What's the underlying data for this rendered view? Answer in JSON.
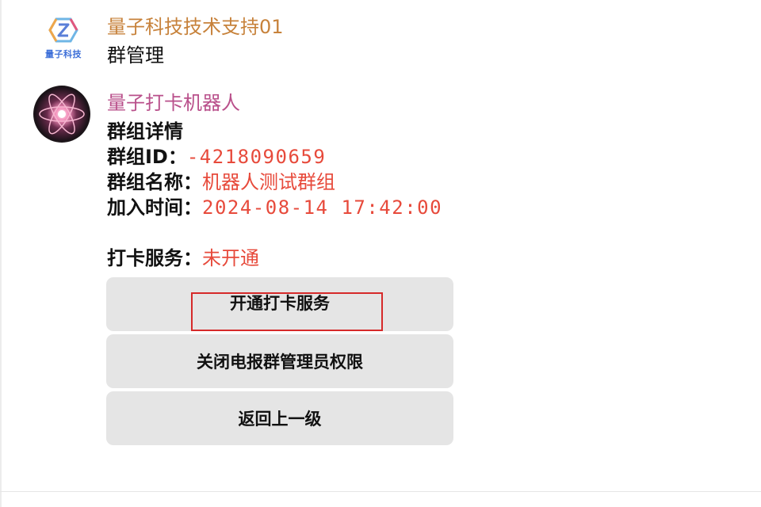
{
  "messages": [
    {
      "sender": "量子科技技术支持01",
      "text": "群管理",
      "avatar_brand": "量子科技",
      "avatar_icon": "quantum-tech-logo-icon"
    },
    {
      "sender": "量子打卡机器人",
      "avatar_icon": "atom-avatar-icon",
      "details": {
        "title": "群组详情",
        "group_id_label": "群组ID：",
        "group_id_value": "-4218090659",
        "group_name_label": "群组名称：",
        "group_name_value": "机器人测试群组",
        "join_time_label": "加入时间：",
        "join_time_value": "2024-08-14 17:42:00",
        "service_label": "打卡服务：",
        "service_value": "未开通"
      },
      "buttons": [
        {
          "label": "开通打卡服务"
        },
        {
          "label": "关闭电报群管理员权限"
        },
        {
          "label": "返回上一级"
        }
      ]
    }
  ],
  "colors": {
    "sender1": "#c7823b",
    "sender2": "#b9508b",
    "value": "#e74a3b",
    "button_bg": "#e5e5e5",
    "highlight": "#d62a2a"
  }
}
